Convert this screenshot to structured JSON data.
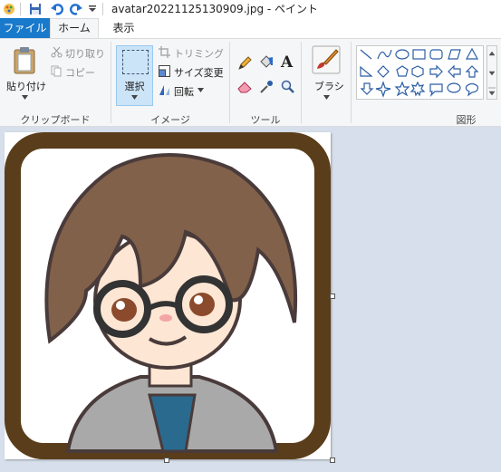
{
  "window": {
    "title": "avatar20221125130909.jpg - ペイント"
  },
  "tabs": {
    "file": "ファイル",
    "home": "ホーム",
    "view": "表示"
  },
  "clipboard": {
    "paste": "貼り付け",
    "cut": "切り取り",
    "copy": "コピー",
    "group": "クリップボード"
  },
  "image": {
    "select": "選択",
    "crop": "トリミング",
    "resize": "サイズ変更",
    "rotate": "回転",
    "group": "イメージ"
  },
  "tools": {
    "group": "ツール"
  },
  "brushes": {
    "label": "ブラシ"
  },
  "shapes": {
    "group": "図形"
  },
  "colors": {
    "accent": "#1979ca",
    "frame": "#5a3d1a",
    "hair": "#82614a",
    "canvas_bg": "#d6dfeb"
  }
}
